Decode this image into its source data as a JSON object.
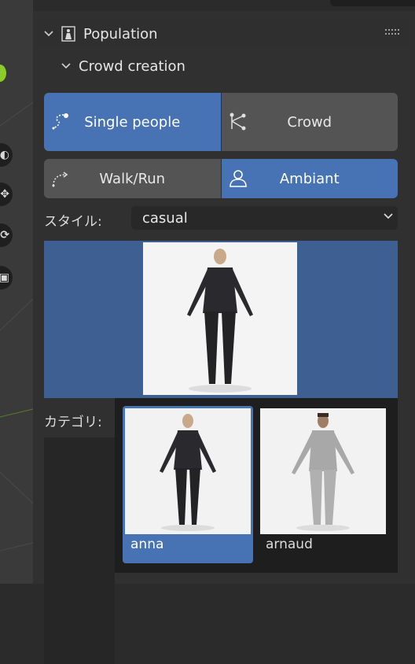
{
  "panel": {
    "title": "Population",
    "subpanel_title": "Crowd creation"
  },
  "mode_row1": [
    {
      "label": "Single people",
      "icon": "single-people-icon",
      "active": true
    },
    {
      "label": "Crowd",
      "icon": "crowd-icon",
      "active": false
    }
  ],
  "mode_row2": [
    {
      "label": "Walk/Run",
      "icon": "walk-run-icon",
      "active": false
    },
    {
      "label": "Ambiant",
      "icon": "person-icon",
      "active": true
    }
  ],
  "style": {
    "label": "スタイル:",
    "value": "casual"
  },
  "category": {
    "label": "カテゴリ:"
  },
  "gallery": {
    "items": [
      {
        "label": "anna",
        "selected": true
      },
      {
        "label": "arnaud",
        "selected": false
      }
    ]
  },
  "colors": {
    "accent": "#4772b3",
    "panel_bg": "#303030",
    "button_bg": "#545454",
    "viewport_green": "#8bcb2c"
  }
}
